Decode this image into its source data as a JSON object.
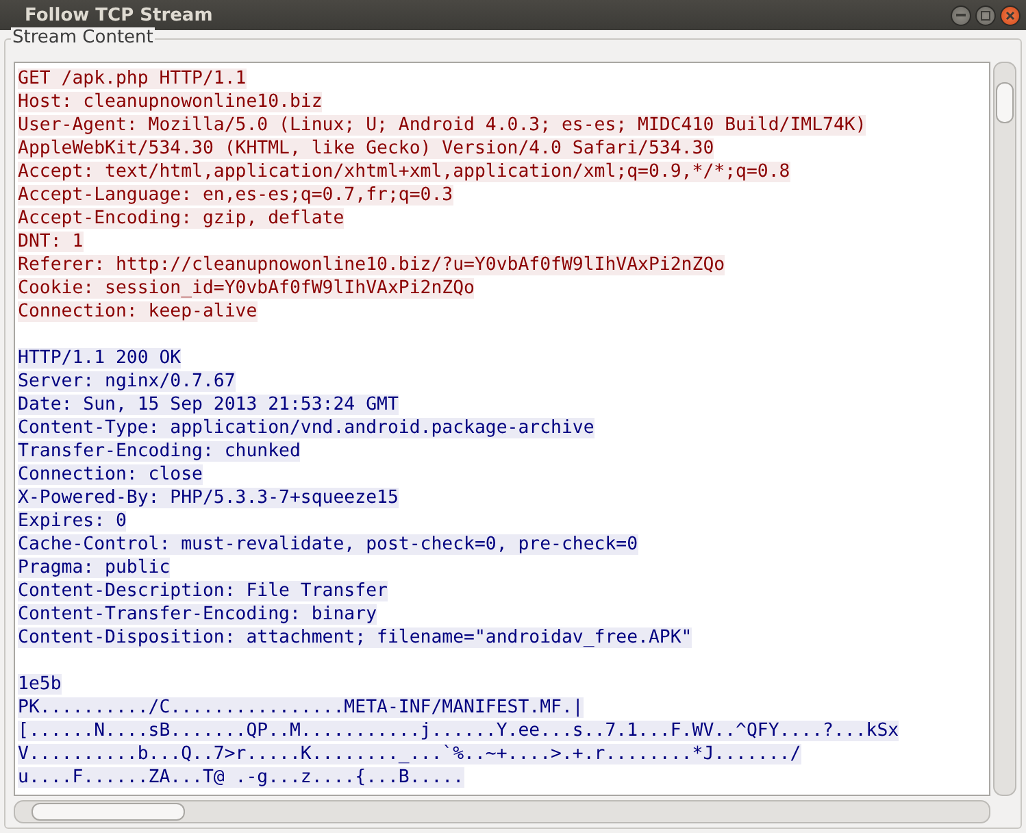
{
  "window": {
    "title": "Follow TCP Stream"
  },
  "frame": {
    "label": "Stream Content"
  },
  "stream": [
    {
      "color": "#8b0000",
      "lines": [
        "GET /apk.php HTTP/1.1",
        "Host: cleanupnowonline10.biz",
        "User-Agent: Mozilla/5.0 (Linux; U; Android 4.0.3; es-es; MIDC410 Build/IML74K)",
        "AppleWebKit/534.30 (KHTML, like Gecko) Version/4.0 Safari/534.30",
        "Accept: text/html,application/xhtml+xml,application/xml;q=0.9,*/*;q=0.8",
        "Accept-Language: en,es-es;q=0.7,fr;q=0.3",
        "Accept-Encoding: gzip, deflate",
        "DNT: 1",
        "Referer: http://cleanupnowonline10.biz/?u=Y0vbAf0fW9lIhVAxPi2nZQo",
        "Cookie: session_id=Y0vbAf0fW9lIhVAxPi2nZQo",
        "Connection: keep-alive"
      ]
    },
    {
      "color": "#000080",
      "lines": [
        "HTTP/1.1 200 OK",
        "Server: nginx/0.7.67",
        "Date: Sun, 15 Sep 2013 21:53:24 GMT",
        "Content-Type: application/vnd.android.package-archive",
        "Transfer-Encoding: chunked",
        "Connection: close",
        "X-Powered-By: PHP/5.3.3-7+squeeze15",
        "Expires: 0",
        "Cache-Control: must-revalidate, post-check=0, pre-check=0",
        "Pragma: public",
        "Content-Description: File Transfer",
        "Content-Transfer-Encoding: binary",
        "Content-Disposition: attachment; filename=\"androidav_free.APK\""
      ]
    },
    {
      "color": "#000080",
      "lines": [
        "1e5b",
        "PK........../C................META-INF/MANIFEST.MF.|",
        "[......N....sB.......QP..M...........j......Y.ee...s..7.1...F.WV..^QFY....?...kSx",
        "V..........b...Q..7>r.....K........_...`%..~+....>.+.r........*J......./",
        "u....F......ZA...T@ .-g...z....{...B....."
      ]
    }
  ]
}
